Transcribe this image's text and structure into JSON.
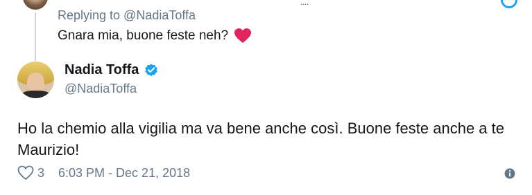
{
  "previous_tweet": {
    "replying_to": "Replying to @NadiaToffa",
    "text": "Gnara mia, buone feste neh?",
    "emoji": "heart-icon"
  },
  "tweet": {
    "author_name": "Nadia Toffa",
    "verified": true,
    "handle": "@NadiaToffa",
    "text": "Ho la chemio alla vigilia ma va bene anche così. Buone feste anche a te Maurizio!",
    "like_count": "3",
    "timestamp": "6:03 PM - Dec 21, 2018"
  },
  "colors": {
    "accent": "#1da1f2",
    "heart": "#e0245e",
    "secondary_text": "#657786",
    "primary_text": "#14171a"
  }
}
